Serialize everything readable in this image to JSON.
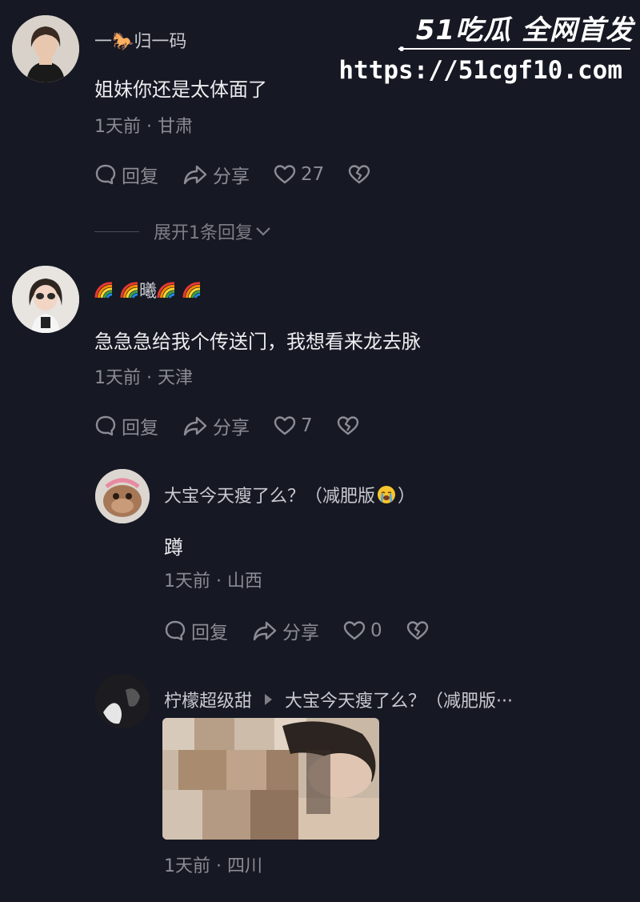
{
  "watermark": {
    "logo": "51吃瓜 全网首发",
    "url": "https://51cgf10.com"
  },
  "comments": [
    {
      "username": "一🐎归一码",
      "text": "姐妹你还是太体面了",
      "meta": "1天前 · 甘肃",
      "reply_label": "回复",
      "share_label": "分享",
      "likes": "27",
      "expand_label": "展开1条回复"
    },
    {
      "username_center": "曦",
      "text": "急急急给我个传送门，我想看来龙去脉",
      "meta": "1天前 · 天津",
      "reply_label": "回复",
      "share_label": "分享",
      "likes": "7",
      "replies": [
        {
          "username": "大宝今天瘦了么？（减肥版",
          "username_tail": "）",
          "text": "蹲",
          "meta": "1天前 · 山西",
          "reply_label": "回复",
          "share_label": "分享",
          "likes": "0"
        },
        {
          "username": "柠檬超级甜",
          "reply_to": "大宝今天瘦了么？（减肥版···",
          "meta": "1天前 · 四川"
        }
      ]
    }
  ]
}
